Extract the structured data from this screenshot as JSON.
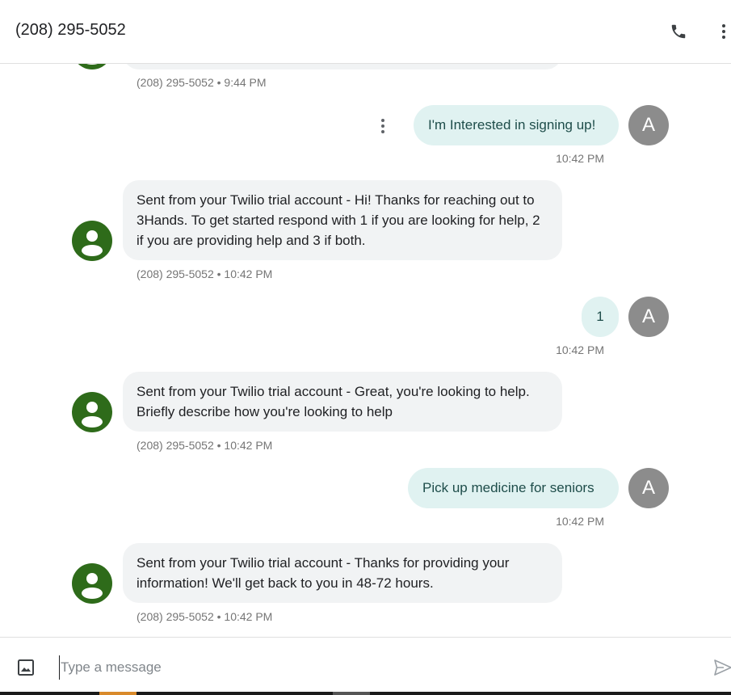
{
  "header": {
    "title": "(208) 295-5052",
    "call_icon": "phone-icon",
    "more_icon": "more-vert-icon"
  },
  "messages": [
    {
      "direction": "in",
      "text": "",
      "meta": "(208) 295-5052 • 9:44 PM"
    },
    {
      "direction": "out",
      "text": "I'm Interested in signing up!",
      "avatar": "A",
      "meta": "10:42 PM"
    },
    {
      "direction": "in",
      "text": "Sent from your Twilio trial account - Hi! Thanks for reaching out to 3Hands. To get started respond with 1 if you are looking for help, 2 if you are providing help and 3 if both.",
      "meta": "(208) 295-5052 • 10:42 PM"
    },
    {
      "direction": "out",
      "text": "1",
      "avatar": "A",
      "meta": "10:42 PM"
    },
    {
      "direction": "in",
      "text": "Sent from your Twilio trial account - Great, you're looking to help. Briefly describe how you're looking to help",
      "meta": "(208) 295-5052 • 10:42 PM"
    },
    {
      "direction": "out",
      "text": "Pick up medicine for seniors",
      "avatar": "A",
      "meta": "10:42 PM"
    },
    {
      "direction": "in",
      "text": "Sent from your Twilio trial account - Thanks for providing your information! We'll get back to you in 48-72 hours.",
      "meta": "(208) 295-5052 • 10:42 PM"
    }
  ],
  "composer": {
    "placeholder": "Type a message",
    "attach_icon": "image-icon",
    "send_icon": "send-icon"
  },
  "colors": {
    "contact_avatar": "#2e6b1a",
    "user_avatar": "#8c8c8c",
    "incoming_bubble": "#f1f3f4",
    "outgoing_bubble": "#e0f2f1"
  }
}
